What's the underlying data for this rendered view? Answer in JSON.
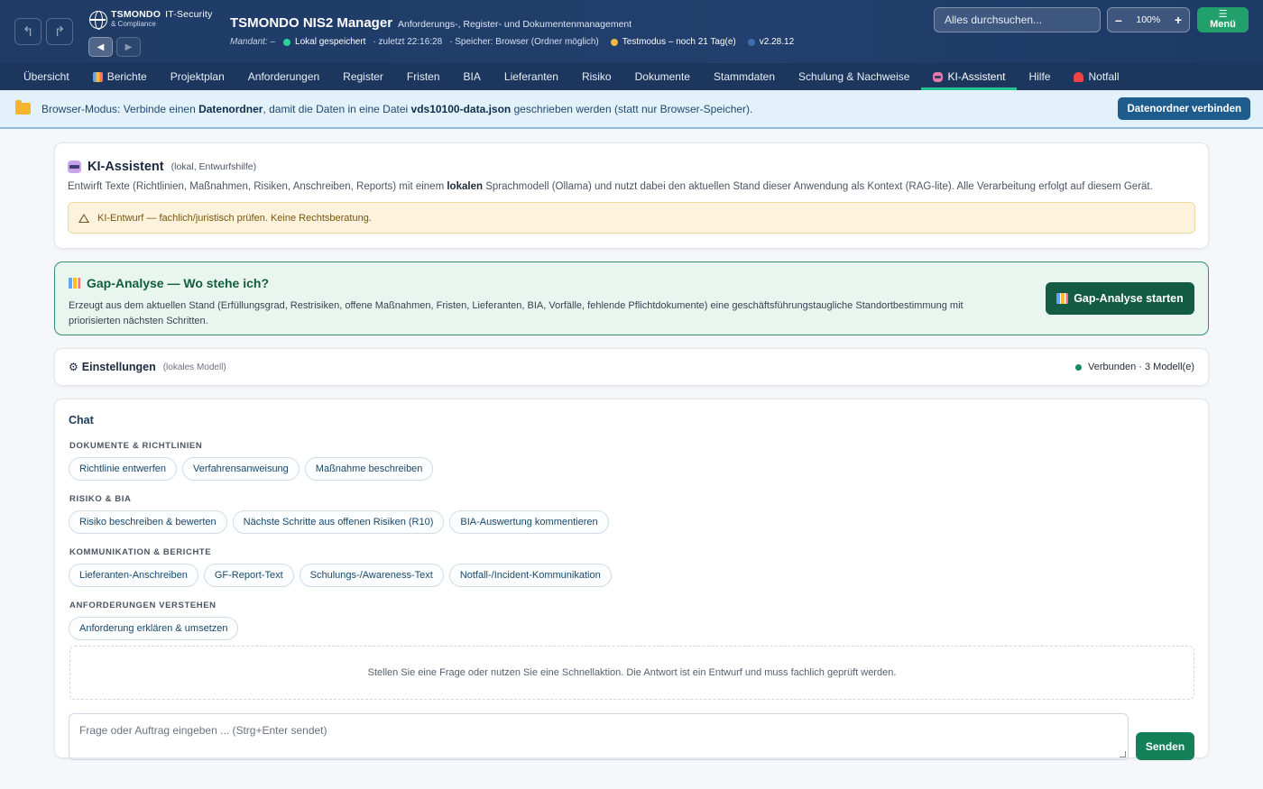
{
  "header": {
    "logo_name": "TSMONDO",
    "logo_tag": "IT-Security",
    "logo_sub": "& Compliance",
    "title": "TSMONDO NIS2 Manager",
    "subtitle": "Anforderungs-, Register- und Dokumentenmanagement",
    "mandant_label": "Mandant: –",
    "save_status": "Lokal gespeichert",
    "last_saved": "· zuletzt 22:16:28",
    "storage": "· Speicher: Browser (Ordner möglich)",
    "test_mode": "Testmodus – noch 21 Tag(e)",
    "version": "v2.28.12",
    "search_placeholder": "Alles durchsuchen...",
    "zoom_minus": "–",
    "zoom_level": "100%",
    "zoom_plus": "+",
    "menu_icon": "☰",
    "menu_label": "Menü"
  },
  "nav": {
    "tabs": [
      {
        "label": "Übersicht"
      },
      {
        "label": "Berichte"
      },
      {
        "label": "Projektplan"
      },
      {
        "label": "Anforderungen"
      },
      {
        "label": "Register"
      },
      {
        "label": "Fristen"
      },
      {
        "label": "BIA"
      },
      {
        "label": "Lieferanten"
      },
      {
        "label": "Risiko"
      },
      {
        "label": "Dokumente"
      },
      {
        "label": "Stammdaten"
      },
      {
        "label": "Schulung & Nachweise"
      },
      {
        "label": "KI-Assistent"
      },
      {
        "label": "Hilfe"
      },
      {
        "label": "Notfall"
      }
    ],
    "active": "KI-Assistent"
  },
  "banner": {
    "text_1": "Browser-Modus: Verbinde einen ",
    "text_bold_1": "Datenordner",
    "text_2": ", damit die Daten in eine Datei ",
    "text_bold_2": "vds10100-data.json",
    "text_3": " geschrieben werden (statt nur Browser-Speicher).",
    "button": "Datenordner verbinden"
  },
  "ki_card": {
    "title": "KI-Assistent",
    "title_note": "(lokal, Entwurfshilfe)",
    "desc_1": "Entwirft Texte (Richtlinien, Maßnahmen, Risiken, Anschreiben, Reports) mit einem ",
    "desc_bold": "lokalen",
    "desc_2": " Sprachmodell (Ollama) und nutzt dabei den aktuellen Stand dieser Anwendung als Kontext (RAG-lite). Alle Verarbeitung erfolgt auf diesem Gerät.",
    "warning": "KI-Entwurf — fachlich/juristisch prüfen. Keine Rechtsberatung."
  },
  "gap_card": {
    "title": "Gap-Analyse — Wo stehe ich?",
    "desc": "Erzeugt aus dem aktuellen Stand (Erfüllungsgrad, Restrisiken, offene Maßnahmen, Fristen, Lieferanten, BIA, Vorfälle, fehlende Pflichtdokumente) eine geschäftsführungstaugliche Standortbestimmung mit priorisierten nächsten Schritten.",
    "button": "Gap-Analyse starten"
  },
  "settings_card": {
    "gear": "⚙",
    "title": "Einstellungen",
    "note": "(lokales Modell)",
    "status": "Verbunden · 3 Modell(e)"
  },
  "chat": {
    "title": "Chat",
    "groups": [
      {
        "label": "DOKUMENTE & RICHTLINIEN",
        "chips": [
          "Richtlinie entwerfen",
          "Verfahrensanweisung",
          "Maßnahme beschreiben"
        ]
      },
      {
        "label": "RISIKO & BIA",
        "chips": [
          "Risiko beschreiben & bewerten",
          "Nächste Schritte aus offenen Risiken (R10)",
          "BIA-Auswertung kommentieren"
        ]
      },
      {
        "label": "KOMMUNIKATION & BERICHTE",
        "chips": [
          "Lieferanten-Anschreiben",
          "GF-Report-Text",
          "Schulungs-/Awareness-Text",
          "Notfall-/Incident-Kommunikation"
        ]
      },
      {
        "label": "ANFORDERUNGEN VERSTEHEN",
        "chips": [
          "Anforderung erklären & umsetzen"
        ]
      }
    ],
    "answer_placeholder": "Stellen Sie eine Frage oder nutzen Sie eine Schnellaktion. Die Antwort ist ein Entwurf und muss fachlich geprüft werden.",
    "input_placeholder": "Frage oder Auftrag eingeben ... (Strg+Enter sendet)",
    "send": "Senden"
  },
  "colors": {
    "header_bg": "#1f3b66",
    "nav_bg": "#1c365e",
    "accent_green": "#135c43",
    "active_tab_underline": "#22c38e",
    "status_saved": "#2bd39a",
    "status_test": "#f4b740",
    "status_version": "#3b6fb0"
  }
}
